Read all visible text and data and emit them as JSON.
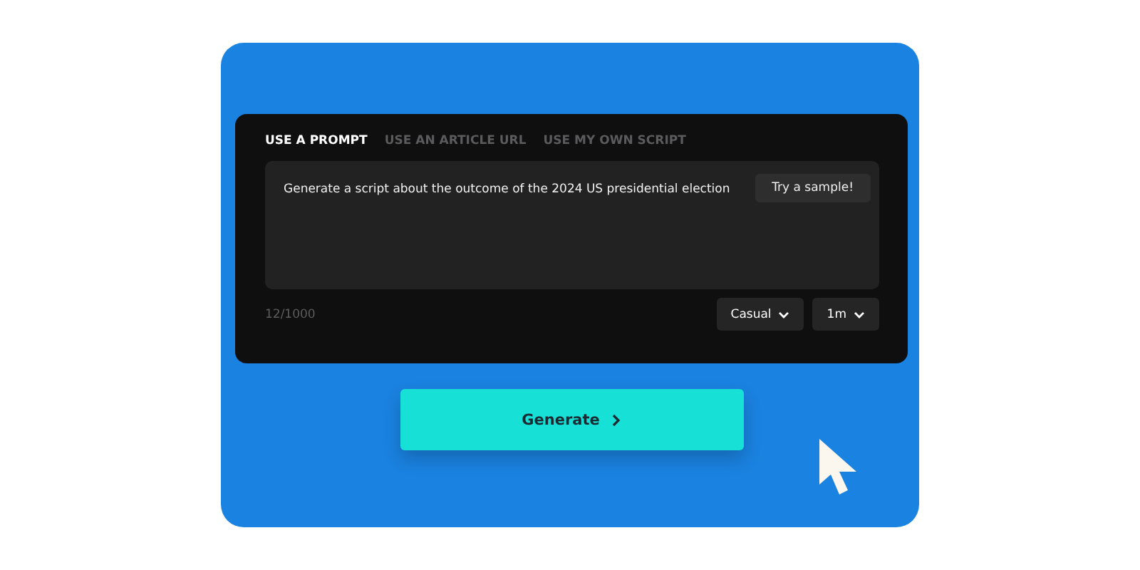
{
  "tabs": [
    {
      "label": "USE A PROMPT",
      "selected": true
    },
    {
      "label": "USE AN ARTICLE URL",
      "selected": false
    },
    {
      "label": "USE MY OWN SCRIPT",
      "selected": false
    }
  ],
  "prompt": {
    "value": "Generate a script about the outcome of the 2024 US presidential election",
    "sample_button": "Try a sample!"
  },
  "counter": "12/1000",
  "dropdowns": [
    {
      "label": "Casual"
    },
    {
      "label": "1m"
    }
  ],
  "generate_button": "Generate"
}
